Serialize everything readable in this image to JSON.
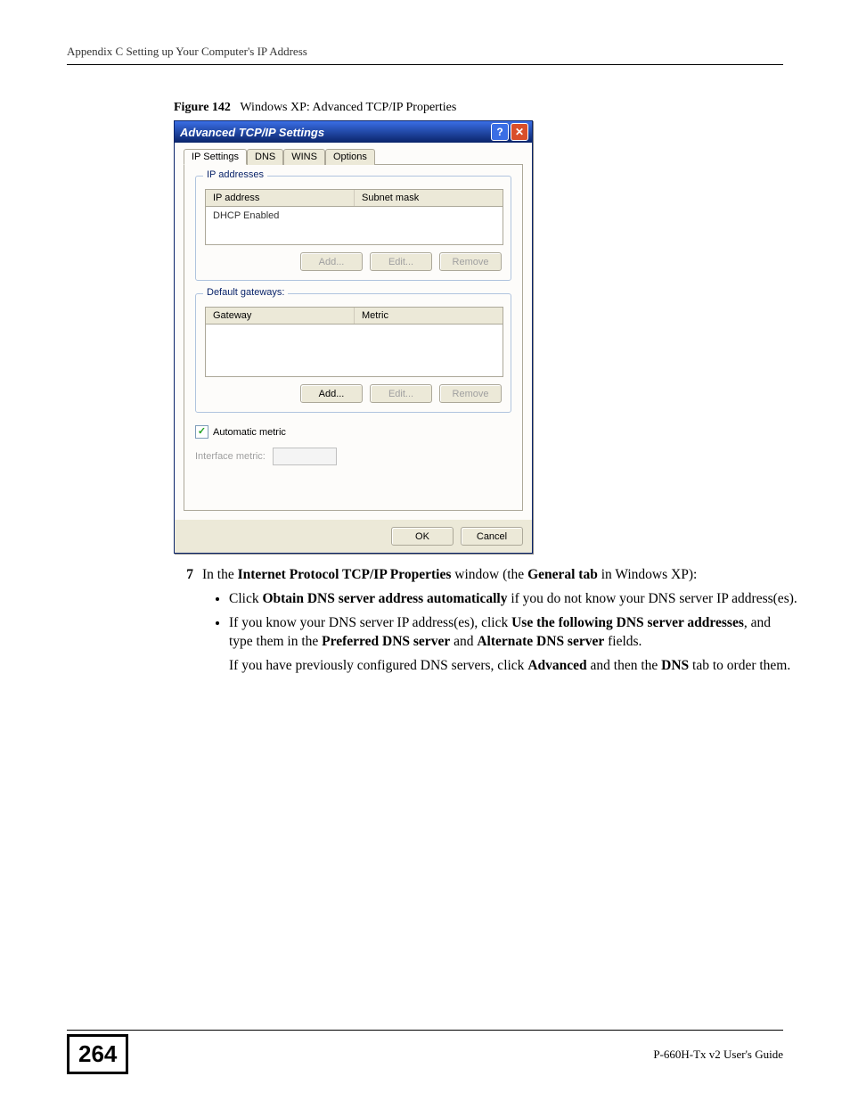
{
  "header": "Appendix C Setting up Your Computer's IP Address",
  "figure": {
    "label": "Figure 142",
    "caption": "Windows XP: Advanced TCP/IP Properties"
  },
  "dialog": {
    "title": "Advanced TCP/IP Settings",
    "help_glyph": "?",
    "close_glyph": "✕",
    "tabs": [
      "IP Settings",
      "DNS",
      "WINS",
      "Options"
    ],
    "ip_group": {
      "legend": "IP addresses",
      "col1": "IP address",
      "col2": "Subnet mask",
      "row1": "DHCP Enabled",
      "add": "Add...",
      "edit": "Edit...",
      "remove": "Remove"
    },
    "gw_group": {
      "legend": "Default gateways:",
      "col1": "Gateway",
      "col2": "Metric",
      "add": "Add...",
      "edit": "Edit...",
      "remove": "Remove"
    },
    "auto_metric": "Automatic metric",
    "iface_metric_label": "Interface metric:",
    "ok": "OK",
    "cancel": "Cancel"
  },
  "step": {
    "num": "7",
    "intro_a": "In the ",
    "intro_b": "Internet Protocol TCP/IP Properties",
    "intro_c": " window (the ",
    "intro_d": "General tab",
    "intro_e": " in Windows XP):",
    "b1_a": "Click ",
    "b1_b": "Obtain DNS server address automatically",
    "b1_c": " if you do not know your DNS server IP address(es).",
    "b2_a": "If you know your DNS server IP address(es), click ",
    "b2_b": "Use the following DNS server addresses",
    "b2_c": ", and type them in the ",
    "b2_d": "Preferred DNS server",
    "b2_e": " and ",
    "b2_f": "Alternate DNS server",
    "b2_g": " fields.",
    "b2_follow_a": "If you have previously configured DNS servers, click ",
    "b2_follow_b": "Advanced",
    "b2_follow_c": " and then the ",
    "b2_follow_d": "DNS",
    "b2_follow_e": " tab to order them."
  },
  "footer": {
    "page": "264",
    "guide": "P-660H-Tx v2 User's Guide"
  }
}
